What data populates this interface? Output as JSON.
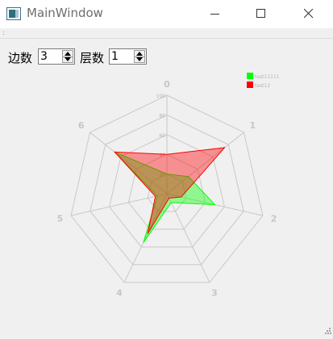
{
  "window": {
    "title": "MainWindow",
    "toolbar_grip": ":"
  },
  "controls": {
    "sides_label": "边数",
    "sides_value": "3",
    "layers_label": "层数",
    "layers_value": "1"
  },
  "chart_data": {
    "type": "radar",
    "axes": [
      "0",
      "1",
      "2",
      "3",
      "4",
      "5",
      "6"
    ],
    "rlim": [
      0,
      100
    ],
    "rings": [
      20,
      40,
      60,
      80,
      100
    ],
    "ring_labels": [
      "20",
      "40",
      "60",
      "80",
      "100"
    ],
    "grid": true,
    "legend_position": "top-right",
    "series": [
      {
        "name": "test11111",
        "color": "#00ff00",
        "values": [
          20,
          28,
          50,
          10,
          55,
          10,
          68
        ]
      },
      {
        "name": "test12",
        "color": "#ff0000",
        "values": [
          40,
          75,
          15,
          5,
          45,
          12,
          68
        ]
      }
    ]
  }
}
